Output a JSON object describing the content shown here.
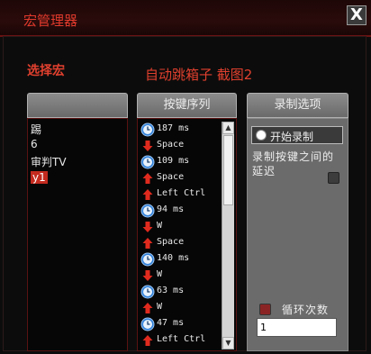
{
  "window": {
    "title": "宏管理器",
    "close_label": "X"
  },
  "macro_section_label": "选择宏",
  "macro_heading": "自动跳箱子 截图2",
  "columns": {
    "macros": "",
    "sequence": "按键序列",
    "options": "录制选项"
  },
  "macros": [
    {
      "label": "踢",
      "selected": false
    },
    {
      "label": "6",
      "selected": false
    },
    {
      "label": "审判TV",
      "selected": false
    },
    {
      "label": "y1",
      "selected": true
    }
  ],
  "sequence": [
    {
      "type": "delay",
      "icon": "clock-icon",
      "text": "187 ms"
    },
    {
      "type": "key_down",
      "icon": "arrow-down-icon",
      "text": "Space"
    },
    {
      "type": "delay",
      "icon": "clock-icon",
      "text": "109 ms"
    },
    {
      "type": "key_up",
      "icon": "arrow-up-icon",
      "text": "Space"
    },
    {
      "type": "key_up",
      "icon": "arrow-up-icon",
      "text": "Left Ctrl"
    },
    {
      "type": "delay",
      "icon": "clock-icon",
      "text": "94 ms"
    },
    {
      "type": "key_down",
      "icon": "arrow-down-icon",
      "text": "W"
    },
    {
      "type": "key_up",
      "icon": "arrow-up-icon",
      "text": "Space"
    },
    {
      "type": "delay",
      "icon": "clock-icon",
      "text": "140 ms"
    },
    {
      "type": "key_down",
      "icon": "arrow-down-icon",
      "text": "W"
    },
    {
      "type": "delay",
      "icon": "clock-icon",
      "text": "63 ms"
    },
    {
      "type": "key_up",
      "icon": "arrow-up-icon",
      "text": "W"
    },
    {
      "type": "delay",
      "icon": "clock-icon",
      "text": "47 ms"
    },
    {
      "type": "key_up",
      "icon": "arrow-up-icon",
      "text": "Left Ctrl"
    }
  ],
  "options": {
    "record_button": "开始录制",
    "record_delay_label": "录制按键之间的延迟",
    "record_delay_checked": false,
    "loop_label": "循环次数",
    "loop_checked": true,
    "loop_count": "1"
  },
  "colors": {
    "accent": "#e0402e",
    "panel_gray": "#6b6b6b",
    "arrow_red": "#e02a1e",
    "clock_blue": "#2f7fd8"
  }
}
